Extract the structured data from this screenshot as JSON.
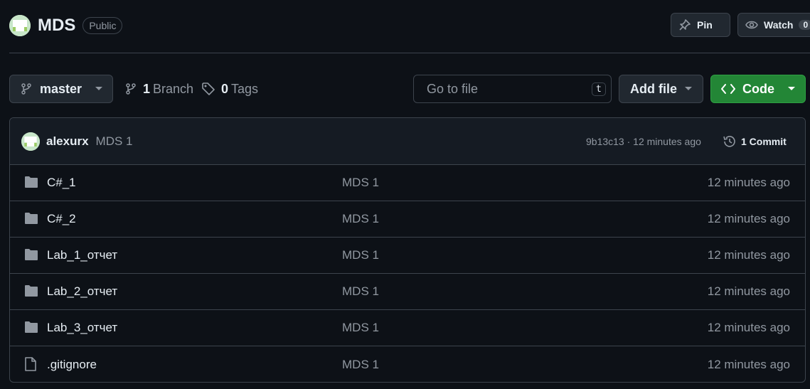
{
  "repo": {
    "name": "MDS",
    "visibility": "Public",
    "pin_label": "Pin",
    "watch_label": "Watch",
    "watch_count": "0"
  },
  "toolbar": {
    "branch": "master",
    "branch_count": "1",
    "branch_label": "Branch",
    "tag_count": "0",
    "tag_label": "Tags",
    "search_placeholder": "Go to file",
    "search_shortcut": "t",
    "add_file_label": "Add file",
    "code_label": "Code"
  },
  "commit": {
    "author": "alexurx",
    "message": "MDS 1",
    "meta": "9b13c13 · 12 minutes ago",
    "commits_label": "1 Commit"
  },
  "files": [
    {
      "name": "C#_1",
      "message": "MDS 1",
      "age": "12 minutes ago",
      "icon": "folder-icon"
    },
    {
      "name": "C#_2",
      "message": "MDS 1",
      "age": "12 minutes ago",
      "icon": "folder-icon"
    },
    {
      "name": "Lab_1_отчет",
      "message": "MDS 1",
      "age": "12 minutes ago",
      "icon": "folder-icon"
    },
    {
      "name": "Lab_2_отчет",
      "message": "MDS 1",
      "age": "12 minutes ago",
      "icon": "folder-icon"
    },
    {
      "name": "Lab_3_отчет",
      "message": "MDS 1",
      "age": "12 minutes ago",
      "icon": "folder-icon"
    },
    {
      "name": ".gitignore",
      "message": "MDS 1",
      "age": "12 minutes ago",
      "icon": "file-icon"
    }
  ],
  "colors": {
    "background": "#0d1117",
    "border": "#3d444d",
    "muted_text": "#9198a1",
    "code_button": "#238636",
    "avatar": "#c8e6c9"
  }
}
